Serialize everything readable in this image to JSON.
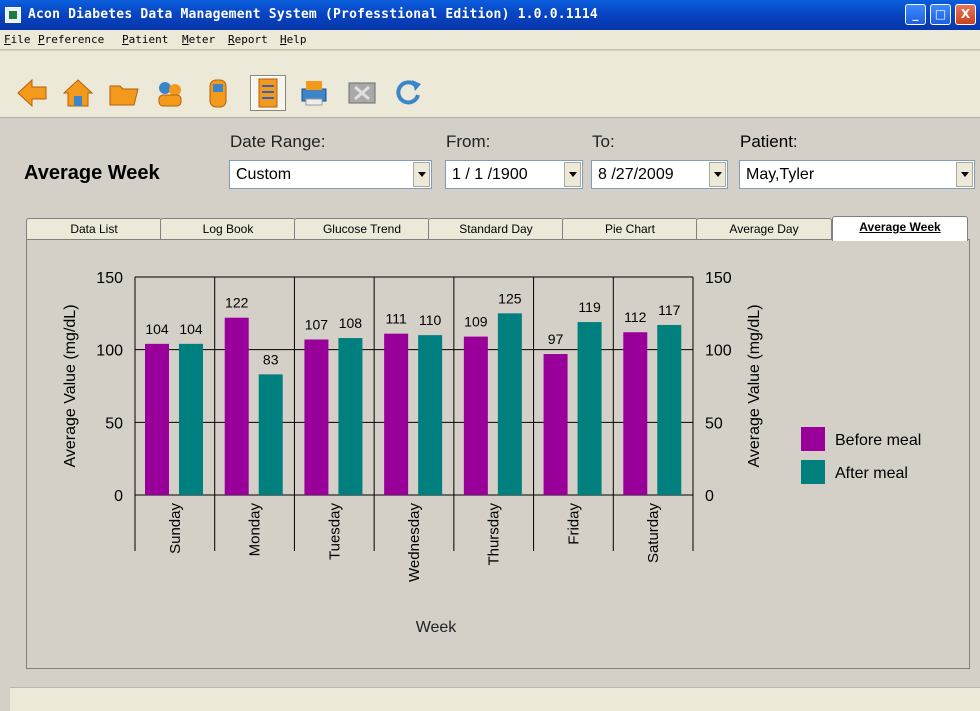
{
  "window": {
    "title": "Acon Diabetes Data Management System (Professtional Edition) 1.0.0.1114",
    "controls": {
      "minimize": "_",
      "maximize": "□",
      "close": "X"
    }
  },
  "menu": [
    "File",
    "Preference",
    "Patient",
    "Meter",
    "Report",
    "Help"
  ],
  "toolbar": {
    "buttons": [
      {
        "name": "back-arrow-icon"
      },
      {
        "name": "home-icon"
      },
      {
        "name": "folder-icon"
      },
      {
        "name": "patient-icon"
      },
      {
        "name": "meter-icon"
      },
      {
        "name": "report-icon",
        "pressed": true
      },
      {
        "name": "printer-icon"
      },
      {
        "name": "excel-export-icon"
      },
      {
        "name": "refresh-icon"
      }
    ]
  },
  "filters": {
    "page_title": "Average Week",
    "date_range_label": "Date Range:",
    "date_range_value": "Custom",
    "from_label": "From:",
    "from_value": "1 / 1 /1900",
    "to_label": "To:",
    "to_value": "8 /27/2009",
    "patient_label": "Patient:",
    "patient_value": "May,Tyler"
  },
  "tabs": [
    {
      "label": "Data List"
    },
    {
      "label": "Log Book"
    },
    {
      "label": "Glucose Trend"
    },
    {
      "label": "Standard Day"
    },
    {
      "label": "Pie Chart"
    },
    {
      "label": "Average Day"
    },
    {
      "label": "Average Week",
      "active": true
    }
  ],
  "colors": {
    "before_meal": "#990099",
    "after_meal": "#007f7f",
    "panel": "#d4d0c8"
  },
  "chart_data": {
    "type": "bar",
    "categories": [
      "Sunday",
      "Monday",
      "Tuesday",
      "Wednesday",
      "Thursday",
      "Friday",
      "Saturday"
    ],
    "series": [
      {
        "name": "Before meal",
        "values": [
          104,
          122,
          107,
          111,
          109,
          97,
          112
        ]
      },
      {
        "name": "After meal",
        "values": [
          104,
          83,
          108,
          110,
          125,
          119,
          117
        ]
      }
    ],
    "xlabel": "Week",
    "ylabel": "Average Value (mg/dL)",
    "ylim": [
      0,
      150
    ],
    "yticks": [
      0,
      50,
      100,
      150
    ],
    "grid": true,
    "legend": "right"
  }
}
